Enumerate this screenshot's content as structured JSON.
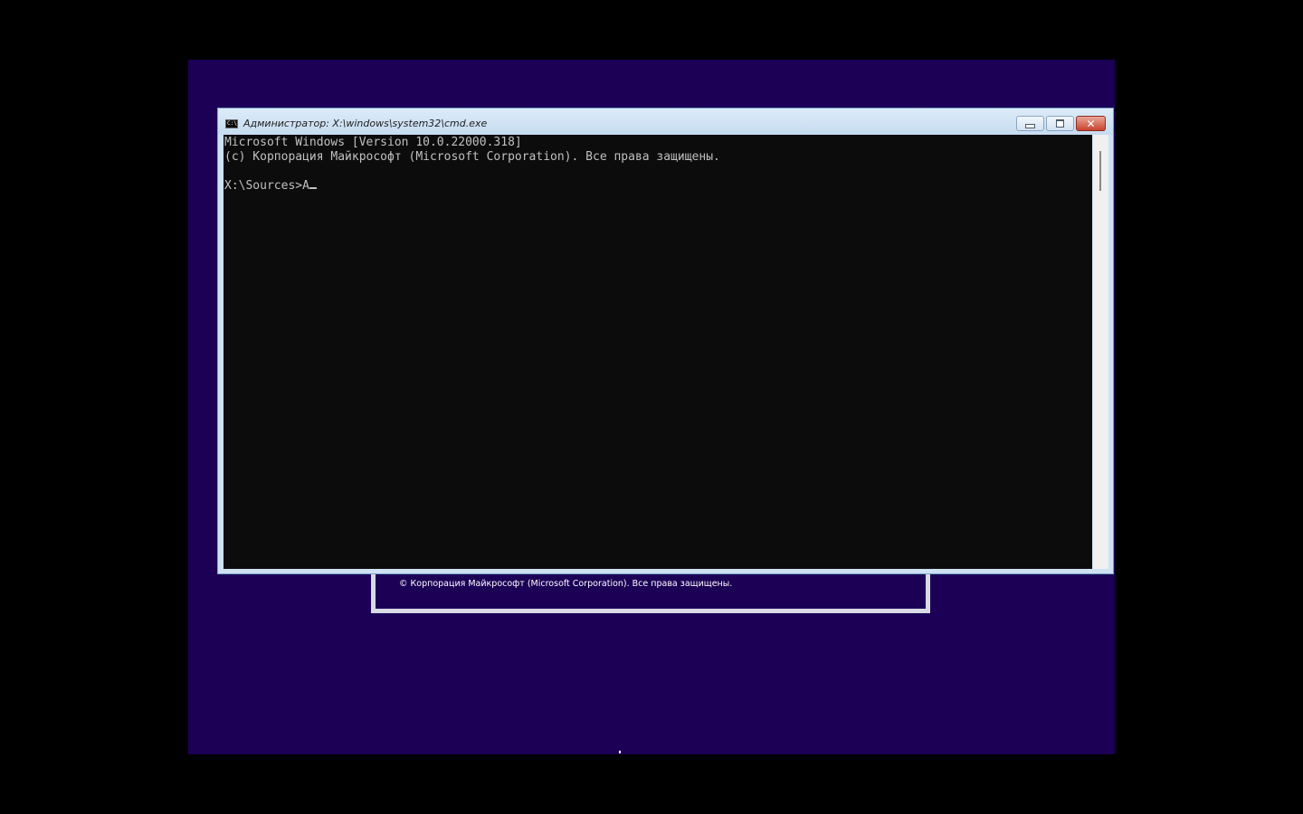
{
  "window": {
    "title": "Администратор: X:\\windows\\system32\\cmd.exe",
    "icon": "cmd-icon",
    "icon_text": "C:\\",
    "controls": {
      "minimize_icon": "minimize-icon",
      "maximize_icon": "maximize-icon",
      "close_icon": "close-icon",
      "close_glyph": "✕"
    }
  },
  "console": {
    "lines": [
      "Microsoft Windows [Version 10.0.22000.318]",
      "(c) Корпорация Майкрософт (Microsoft Corporation). Все права защищены.",
      ""
    ],
    "prompt": "X:\\Sources>",
    "input": "A"
  },
  "setup_dialog": {
    "copyright": "© Корпорация Майкрософт (Microsoft Corporation). Все права защищены."
  },
  "colors": {
    "desktop": "#1b0056",
    "console_bg": "#0c0c0c",
    "console_fg": "#c0c0c0",
    "window_frame": "#cfe1f3",
    "close_button": "#c8442f"
  }
}
